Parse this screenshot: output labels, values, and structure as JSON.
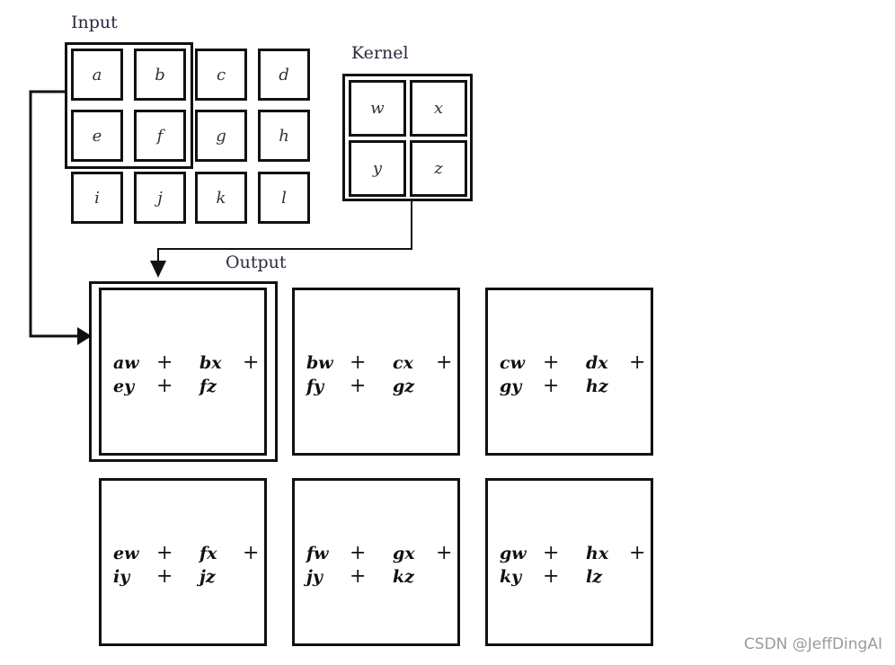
{
  "input": {
    "label": "Input",
    "cells": [
      [
        "a",
        "b",
        "c",
        "d"
      ],
      [
        "e",
        "f",
        "g",
        "h"
      ],
      [
        "i",
        "j",
        "k",
        "l"
      ]
    ]
  },
  "kernel": {
    "label": "Kernel",
    "cells": [
      [
        "w",
        "x"
      ],
      [
        "y",
        "z"
      ]
    ]
  },
  "output": {
    "label": "Output",
    "boxes": [
      {
        "terms": [
          "aw",
          "bx",
          "ey",
          "fz"
        ]
      },
      {
        "terms": [
          "bw",
          "cx",
          "fy",
          "gz"
        ]
      },
      {
        "terms": [
          "cw",
          "dx",
          "gy",
          "hz"
        ]
      },
      {
        "terms": [
          "ew",
          "fx",
          "iy",
          "jz"
        ]
      },
      {
        "terms": [
          "fw",
          "gx",
          "jy",
          "kz"
        ]
      },
      {
        "terms": [
          "gw",
          "hx",
          "ky",
          "lz"
        ]
      }
    ],
    "operator": "+"
  },
  "watermark": "CSDN @JeffDingAI"
}
